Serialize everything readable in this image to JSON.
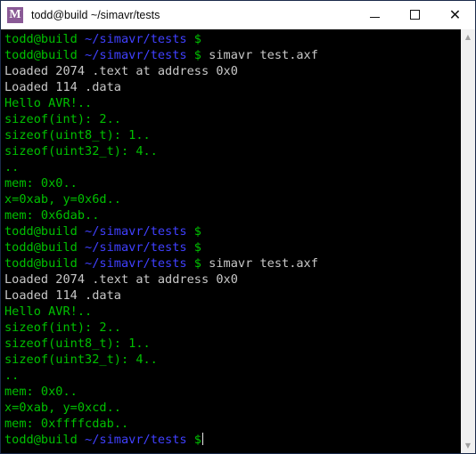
{
  "window": {
    "title": "todd@build ~/simavr/tests",
    "icon_name": "mintty-m-icon",
    "icon_letter": "M",
    "icon_color": "#8a5a96",
    "controls": {
      "minimize_label": "—",
      "maximize_label": "□",
      "close_label": "✕"
    }
  },
  "theme": {
    "background": "#000000",
    "prompt_user_color": "#00c000",
    "prompt_path_color": "#4040ff",
    "output_green": "#00c000",
    "output_white": "#c8c8c8",
    "cursor_color": "#e8e8e8",
    "titlebar_background": "#ffffff",
    "titlebar_text": "#0a0a0a",
    "scrollbar_background": "#f0f0f0"
  },
  "terminal": {
    "prompt": {
      "user_host": "todd@build",
      "path": "~/simavr/tests",
      "symbol": "$"
    },
    "lines": [
      {
        "id": 1,
        "type": "prompt",
        "command": ""
      },
      {
        "id": 2,
        "type": "prompt",
        "command": "simavr test.axf"
      },
      {
        "id": 3,
        "type": "output",
        "color": "white",
        "text": "Loaded 2074 .text at address 0x0"
      },
      {
        "id": 4,
        "type": "output",
        "color": "white",
        "text": "Loaded 114 .data"
      },
      {
        "id": 5,
        "type": "output",
        "color": "green",
        "text": "Hello AVR!.."
      },
      {
        "id": 6,
        "type": "output",
        "color": "green",
        "text": "sizeof(int): 2.."
      },
      {
        "id": 7,
        "type": "output",
        "color": "green",
        "text": "sizeof(uint8_t): 1.."
      },
      {
        "id": 8,
        "type": "output",
        "color": "green",
        "text": "sizeof(uint32_t): 4.."
      },
      {
        "id": 9,
        "type": "output",
        "color": "green",
        "text": ".."
      },
      {
        "id": 10,
        "type": "output",
        "color": "green",
        "text": "mem: 0x0.."
      },
      {
        "id": 11,
        "type": "output",
        "color": "green",
        "text": "x=0xab, y=0x6d.."
      },
      {
        "id": 12,
        "type": "output",
        "color": "green",
        "text": "mem: 0x6dab.."
      },
      {
        "id": 13,
        "type": "prompt",
        "command": ""
      },
      {
        "id": 14,
        "type": "prompt",
        "command": ""
      },
      {
        "id": 15,
        "type": "prompt",
        "command": "simavr test.axf"
      },
      {
        "id": 16,
        "type": "output",
        "color": "white",
        "text": "Loaded 2074 .text at address 0x0"
      },
      {
        "id": 17,
        "type": "output",
        "color": "white",
        "text": "Loaded 114 .data"
      },
      {
        "id": 18,
        "type": "output",
        "color": "green",
        "text": "Hello AVR!.."
      },
      {
        "id": 19,
        "type": "output",
        "color": "green",
        "text": "sizeof(int): 2.."
      },
      {
        "id": 20,
        "type": "output",
        "color": "green",
        "text": "sizeof(uint8_t): 1.."
      },
      {
        "id": 21,
        "type": "output",
        "color": "green",
        "text": "sizeof(uint32_t): 4.."
      },
      {
        "id": 22,
        "type": "output",
        "color": "green",
        "text": ".."
      },
      {
        "id": 23,
        "type": "output",
        "color": "green",
        "text": "mem: 0x0.."
      },
      {
        "id": 24,
        "type": "output",
        "color": "green",
        "text": "x=0xab, y=0xcd.."
      },
      {
        "id": 25,
        "type": "output",
        "color": "green",
        "text": "mem: 0xffffcdab.."
      },
      {
        "id": 26,
        "type": "prompt",
        "command": "",
        "cursor": true
      }
    ]
  },
  "scrollbar": {
    "up_arrow": "▲",
    "down_arrow": "▼",
    "position": "top"
  }
}
